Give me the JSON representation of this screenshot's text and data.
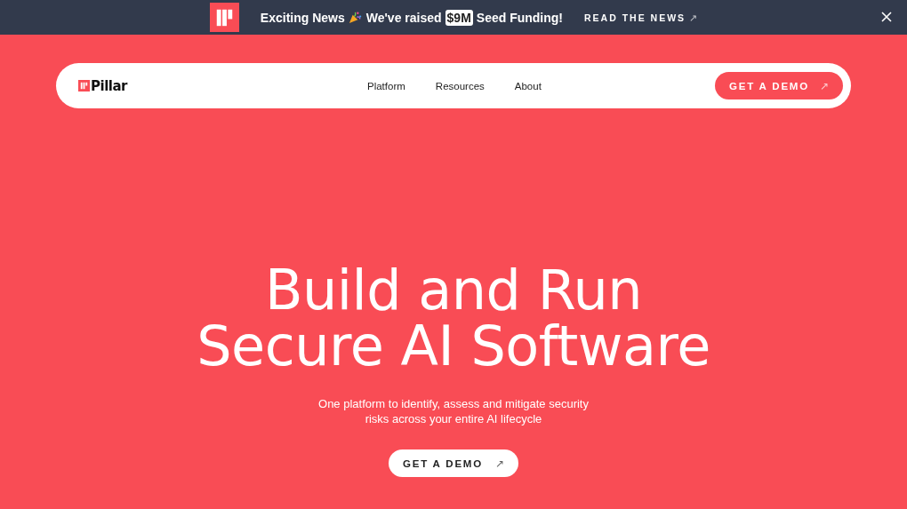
{
  "announcement": {
    "lead": "Exciting News",
    "message": "We've raised",
    "highlight": "$9M",
    "trail": "Seed Funding!",
    "link": {
      "label": "READ THE NEWS",
      "arrow": "↗"
    }
  },
  "navbar": {
    "logo": "Pillar",
    "links": [
      {
        "label": "Platform"
      },
      {
        "label": "Resources"
      },
      {
        "label": "About"
      }
    ],
    "cta": {
      "label": "GET A DEMO",
      "arrow": "↗"
    }
  },
  "hero": {
    "title_lines": [
      "Build and Run",
      "Secure AI Software"
    ],
    "subtitle": "One platform to identify, assess and mitigate security risks across your entire AI lifecycle",
    "cta": {
      "label": "GET A DEMO",
      "arrow": "↗"
    }
  }
}
